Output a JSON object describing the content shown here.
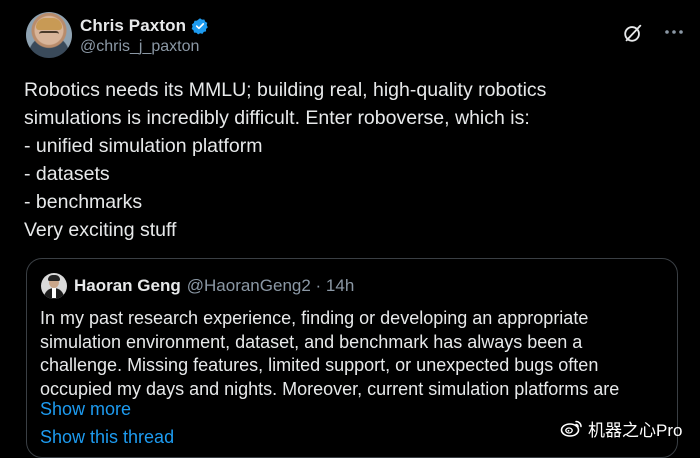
{
  "author": {
    "display_name": "Chris Paxton",
    "handle": "@chris_j_paxton"
  },
  "tweet": {
    "text": "Robotics needs its MMLU; building real, high-quality robotics\nsimulations is incredibly difficult. Enter roboverse, which is:\n- unified simulation platform\n- datasets\n- benchmarks\nVery exciting stuff"
  },
  "quote": {
    "display_name": "Haoran Geng",
    "handle_time": "@HaoranGeng2 · 14h",
    "text": "In my past research experience, finding or developing an appropriate\nsimulation environment, dataset, and benchmark has always been a\nchallenge. Missing features, limited support, or unexpected bugs often\noccupied my days and nights. Moreover, current simulation platforms are",
    "show_more": "Show more",
    "show_thread": "Show this thread"
  },
  "watermark": {
    "text": "机器之心Pro"
  },
  "colors": {
    "background": "#000000",
    "text": "#e7e9ea",
    "secondary": "#8b98a5",
    "link": "#1d9bf0",
    "verified": "#1d9bf0"
  },
  "icons": [
    "verified-badge-icon",
    "grok-icon",
    "more-icon",
    "weibo-icon"
  ]
}
